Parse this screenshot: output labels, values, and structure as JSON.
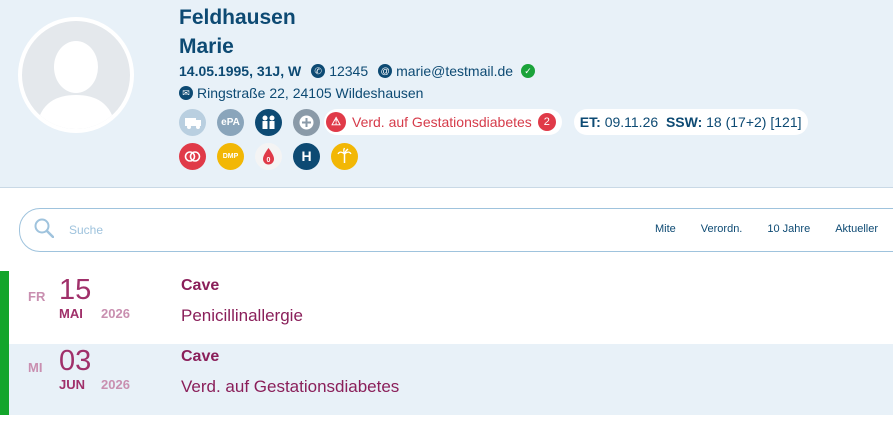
{
  "patient": {
    "last_name": "Feldhausen",
    "first_name": "Marie",
    "birth_info": "14.05.1995, 31J, W",
    "phone": "12345",
    "email": "marie@testmail.de",
    "address": "Ringstraße  22, 24105 Wildeshausen"
  },
  "badges": [
    "ambulance-icon",
    "ePA",
    "family-icon",
    "plus-icon"
  ],
  "warning": {
    "label": "Verd. auf Gestationsdiabetes",
    "count": "2"
  },
  "pregnancy": {
    "et_label": "ET:",
    "et_value": "09.11.26",
    "ssw_label": "SSW:",
    "ssw_value": "18 (17+2) [121]"
  },
  "badges2": [
    "rings-icon",
    "DMP",
    "0",
    "H",
    "palm-icon"
  ],
  "search": {
    "placeholder": "Suche"
  },
  "filters": [
    "Mite",
    "Verordn.",
    "10 Jahre",
    "Aktueller"
  ],
  "entries": [
    {
      "dow": "FR",
      "day": "15",
      "month": "MAI",
      "year": "2026",
      "title": "Cave",
      "text": "Penicillinallergie"
    },
    {
      "dow": "MI",
      "day": "03",
      "month": "JUN",
      "year": "2026",
      "title": "Cave",
      "text": "Verd. auf Gestationsdiabetes"
    }
  ],
  "colors": {
    "primary": "#0d4a73",
    "accent_warn": "#e03a48",
    "entry_text": "#8a1f5a",
    "status_green": "#13a52b"
  }
}
